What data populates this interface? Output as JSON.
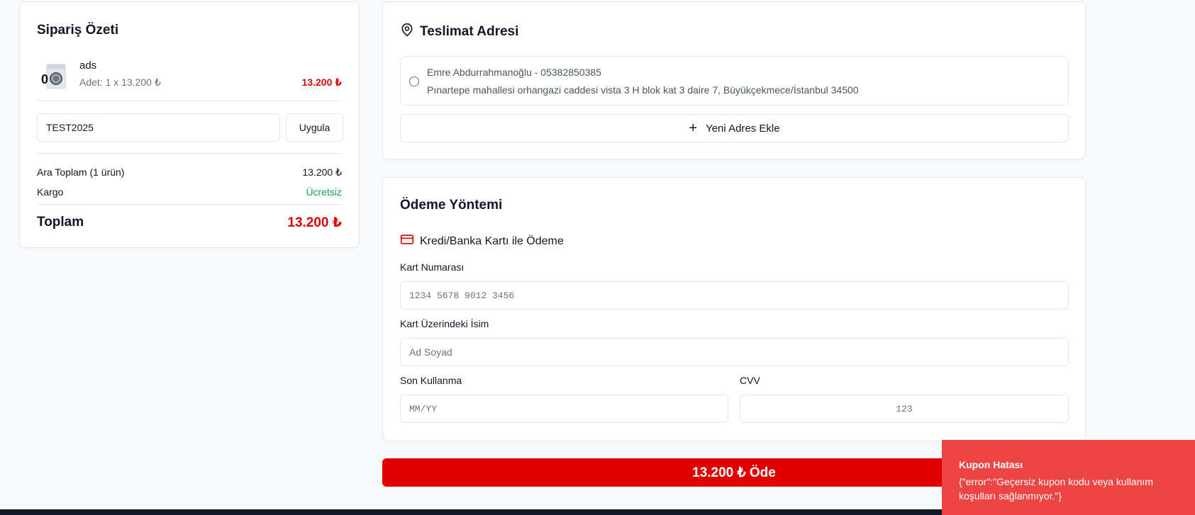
{
  "summary": {
    "title": "Sipariş Özeti",
    "product": {
      "name": "ads",
      "quantity_text": "Adet: 1 x 13.200 ₺",
      "price": "13.200 ₺"
    },
    "coupon": {
      "value": "TEST2025",
      "apply_label": "Uygula"
    },
    "subtotal_label": "Ara Toplam (1 ürün)",
    "subtotal_value": "13.200 ₺",
    "shipping_label": "Kargo",
    "shipping_value": "Ücretsiz",
    "total_label": "Toplam",
    "total_value": "13.200 ₺"
  },
  "address": {
    "title": "Teslimat Adresi",
    "icon": "map-pin-icon",
    "saved": {
      "name_phone": "Emre Abdurrahmanoğlu - 05382850385",
      "line": "Pınartepe mahallesi orhangazi caddesi vista 3 H blok kat 3 daire 7, Büyükçekmece/İstanbul 34500"
    },
    "add_new_label": "Yeni Adres Ekle"
  },
  "payment": {
    "title": "Ödeme Yöntemi",
    "method_label": "Kredi/Banka Kartı ile Ödeme",
    "method_icon": "credit-card-icon",
    "card_number_label": "Kart Numarası",
    "card_number_placeholder": "1234 5678 9012 3456",
    "card_name_label": "Kart Üzerindeki İsim",
    "card_name_placeholder": "Ad Soyad",
    "expiry_label": "Son Kullanma",
    "expiry_placeholder": "MM/YY",
    "cvv_label": "CVV",
    "cvv_placeholder": "123",
    "pay_button_label": "13.200 ₺ Öde"
  },
  "toast": {
    "title": "Kupon Hatası",
    "message": "{\"error\":\"Geçersiz kupon kodu veya kullanım koşulları sağlanmıyor.\"}"
  },
  "colors": {
    "accent": "#e00000",
    "price": "#dc0000",
    "success": "#16a34a",
    "toast_bg": "#ef4444"
  }
}
